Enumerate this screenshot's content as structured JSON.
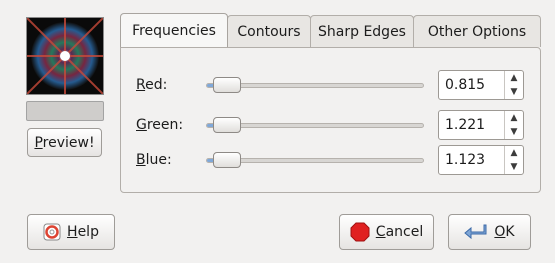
{
  "preview": {
    "button_label": "Preview!"
  },
  "tabs": [
    {
      "label": "Frequencies",
      "active": true
    },
    {
      "label": "Contours",
      "active": false
    },
    {
      "label": "Sharp Edges",
      "active": false
    },
    {
      "label": "Other Options",
      "active": false
    }
  ],
  "sliders": [
    {
      "label": "Red:",
      "value": "0.815"
    },
    {
      "label": "Green:",
      "value": "1.221"
    },
    {
      "label": "Blue:",
      "value": "1.123"
    }
  ],
  "buttons": {
    "help": "Help",
    "cancel": "Cancel",
    "ok": "OK"
  },
  "colors": {
    "accent": "#80a8d8",
    "cancel_icon": "#e02020"
  }
}
